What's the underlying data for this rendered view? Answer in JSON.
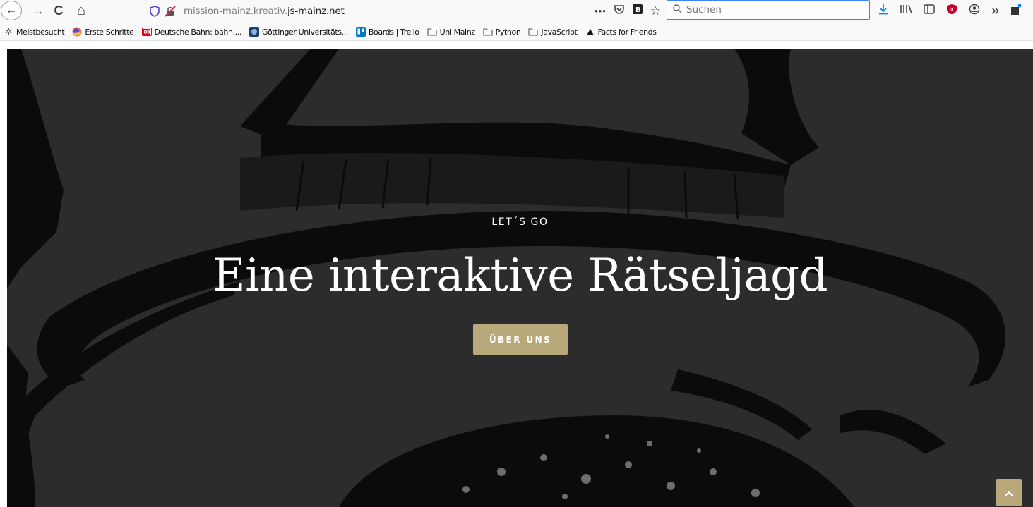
{
  "browser": {
    "url_prefix": "mission-mainz.kreativ.",
    "url_domain": "js-mainz.net",
    "search_placeholder": "Suchen",
    "page_actions_icon": "•••",
    "back_icon": "←",
    "forward_icon": "→",
    "reload_icon": "C",
    "home_icon": "⌂",
    "overflow_icon": "»"
  },
  "bookmarks": [
    {
      "label": "Meistbesucht",
      "icon": "gear-icon"
    },
    {
      "label": "Erste Schritte",
      "icon": "firefox-icon"
    },
    {
      "label": "Deutsche Bahn: bahn....",
      "icon": "db-icon"
    },
    {
      "label": "Göttinger Universitäts...",
      "icon": "library-icon"
    },
    {
      "label": "Boards | Trello",
      "icon": "trello-icon"
    },
    {
      "label": "Uni Mainz",
      "icon": "folder-icon"
    },
    {
      "label": "Python",
      "icon": "folder-icon"
    },
    {
      "label": "JavaScript",
      "icon": "folder-icon"
    },
    {
      "label": "Facts for Friends",
      "icon": "triangle-icon"
    }
  ],
  "hero": {
    "kicker": "LET´S GO",
    "headline": "Eine interaktive Rätseljagd",
    "cta_label": "ÜBER UNS",
    "to_top_icon": "^"
  },
  "colors": {
    "accent": "#b9a879",
    "page_background": "#2c2c2c"
  }
}
